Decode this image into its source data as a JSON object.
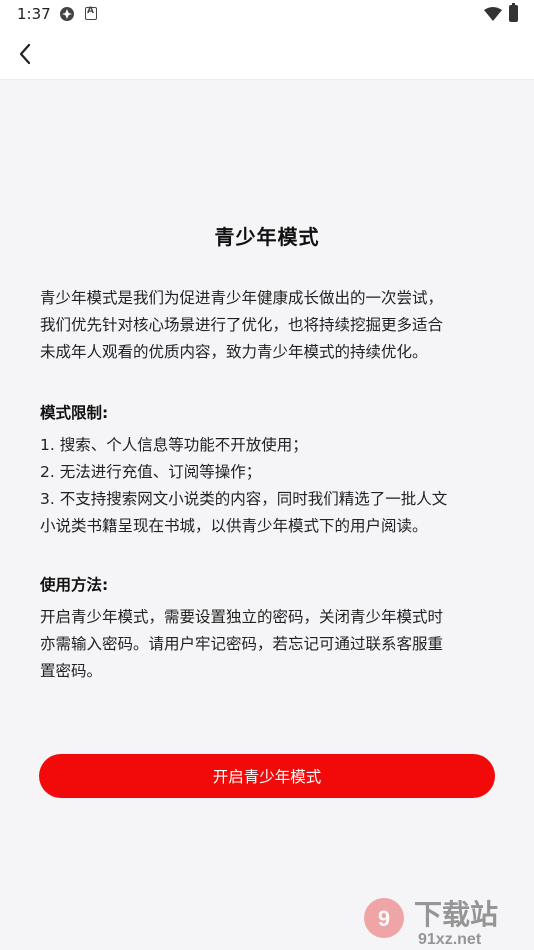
{
  "status_bar": {
    "time": "1:37"
  },
  "page": {
    "title": "青少年模式",
    "intro": [
      "青少年模式是我们为促进青少年健康成长做出的一次尝试，",
      "我们优先针对核心场景进行了优化，也将持续挖掘更多适合",
      "未成年人观看的优质内容，致力青少年模式的持续优化。"
    ],
    "restrictions": {
      "heading": "模式限制:",
      "items": [
        "1. 搜索、个人信息等功能不开放使用；",
        "2. 无法进行充值、订阅等操作；",
        "3. 不支持搜索网文小说类的内容，同时我们精选了一批人文",
        "小说类书籍呈现在书城，以供青少年模式下的用户阅读。"
      ]
    },
    "usage": {
      "heading": "使用方法:",
      "lines": [
        "开启青少年模式，需要设置独立的密码，关闭青少年模式时",
        "亦需输入密码。请用户牢记密码，若忘记可通过联系客服重",
        "置密码。"
      ]
    },
    "cta_label": "开启青少年模式"
  },
  "watermark": {
    "text_cn": "下载站",
    "text_url": "91xz.net"
  },
  "colors": {
    "accent": "#f20a0a",
    "background": "#f5f5f7"
  },
  "icons": [
    "back-arrow-icon",
    "wifi-icon",
    "battery-icon"
  ]
}
